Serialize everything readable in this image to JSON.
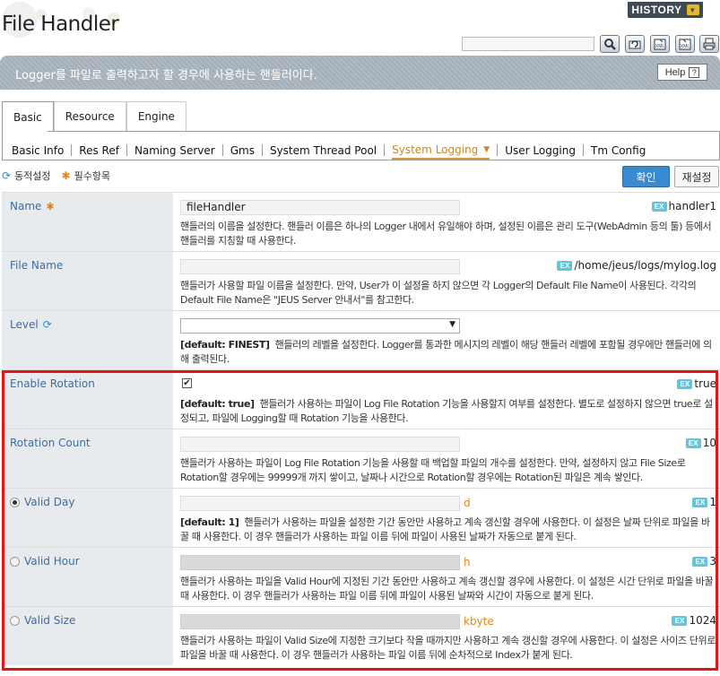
{
  "header": {
    "title": "File Handler",
    "history_label": "HISTORY",
    "search_placeholder": ""
  },
  "toolbar": {
    "icons": [
      "search-icon",
      "refresh-icon",
      "export-xml-icon",
      "import-xml-icon",
      "print-icon"
    ]
  },
  "banner": {
    "text": "Logger를 파일로 출력하고자 할 경우에 사용하는 핸들러이다.",
    "help_label": "Help",
    "help_icon": "?"
  },
  "main_tabs": [
    {
      "label": "Basic",
      "active": true
    },
    {
      "label": "Resource",
      "active": false
    },
    {
      "label": "Engine",
      "active": false
    }
  ],
  "sub_tabs": [
    {
      "label": "Basic Info"
    },
    {
      "label": "Res Ref"
    },
    {
      "label": "Naming Server"
    },
    {
      "label": "Gms"
    },
    {
      "label": "System Thread Pool"
    },
    {
      "label": "System Logging",
      "active": true
    },
    {
      "label": "User Logging"
    },
    {
      "label": "Tm Config"
    }
  ],
  "legend": {
    "dynamic_label": "동적설정",
    "required_label": "필수항목"
  },
  "actions": {
    "confirm_label": "확인",
    "reset_label": "재설정"
  },
  "colors": {
    "banner": "#a9b4bd",
    "label_bg": "#e7ebee",
    "label_text": "#3a6ea5",
    "accent_orange": "#e2861c",
    "confirm_blue": "#3a8ad0",
    "highlight_red": "#e41515",
    "ex_badge": "#5cc7dd"
  },
  "fields": {
    "name": {
      "label": "Name",
      "value": "fileHandler",
      "ex_badge": "EX",
      "example": "handler1",
      "desc": "핸들러의 이름을 설정한다. 핸들러 이름은 하나의 Logger 내에서 유일해야 하며, 설정된 이름은 관리 도구(WebAdmin 등의 툴) 등에서 핸들러를 지칭할 때 사용한다."
    },
    "file_name": {
      "label": "File Name",
      "value": "",
      "ex_badge": "EX",
      "example": "/home/jeus/logs/mylog.log",
      "desc": "핸들러가 사용할 파일 이름을 설정한다. 만약, User가 이 설정을 하지 않으면 각 Logger의 Default File Name이 사용된다. 각각의 Default File Name은 \"JEUS Server 안내서\"를 참고한다."
    },
    "level": {
      "label": "Level",
      "selected": "",
      "default": "[default: FINEST]",
      "desc": "핸들러의 레벨을 설정한다. Logger를 통과한 메시지의 레벨이 해당 핸들러 레벨에 포함될 경우에만 핸들러에 의해 출력된다."
    },
    "enable_rotation": {
      "label": "Enable Rotation",
      "checked": true,
      "check_mark": "✔",
      "ex_badge": "EX",
      "example": "true",
      "default": "[default: true]",
      "desc": "핸들러가 사용하는 파일이 Log File Rotation 기능을 사용할지 여부를 설정한다. 별도로 설정하지 않으면 true로 설정되고, 파일에 Logging할 때 Rotation 기능을 사용한다."
    },
    "rotation_count": {
      "label": "Rotation Count",
      "value": "",
      "ex_badge": "EX",
      "example": "10",
      "desc": "핸들러가 사용하는 파일이 Log File Rotation 기능을 사용할 때 백업할 파일의 개수를 설정한다. 만약, 설정하지 않고 File Size로 Rotation할 경우에는 99999개 까지 쌓이고, 날짜나 시간으로 Rotation할 경우에는 Rotation된 파일은 계속 쌓인다."
    },
    "valid_day": {
      "label": "Valid Day",
      "selected": true,
      "value": "",
      "unit": "d",
      "ex_badge": "EX",
      "example": "1",
      "default": "[default: 1]",
      "desc": "핸들러가 사용하는 파일을 설정한 기간 동안만 사용하고 계속 갱신할 경우에 사용한다. 이 설정은 날짜 단위로 파일을 바꿀 때 사용한다. 이 경우 핸들러가 사용하는 파일 이름 뒤에 파일이 사용된 날짜가 자동으로 붙게 된다."
    },
    "valid_hour": {
      "label": "Valid Hour",
      "selected": false,
      "value": "",
      "unit": "h",
      "ex_badge": "EX",
      "example": "3",
      "desc": "핸들러가 사용하는 파일을 Valid Hour에 지정된 기간 동안만 사용하고 계속 갱신할 경우에 사용한다. 이 설정은 시간 단위로 파일을 바꿀 때 사용한다. 이 경우 핸들러가 사용하는 파일 이름 뒤에 파일이 사용된 날짜와 시간이 자동으로 붙게 된다."
    },
    "valid_size": {
      "label": "Valid Size",
      "selected": false,
      "value": "",
      "unit": "kbyte",
      "ex_badge": "EX",
      "example": "1024",
      "desc": "핸들러가 사용하는 파일이 Valid Size에 지정한 크기보다 작을 때까지만 사용하고 계속 갱신할 경우에 사용한다. 이 설정은 사이즈 단위로 파일을 바꿀 때 사용한다. 이 경우 핸들러가 사용하는 파일 이름 뒤에 순차적으로 Index가 붙게 된다."
    }
  }
}
